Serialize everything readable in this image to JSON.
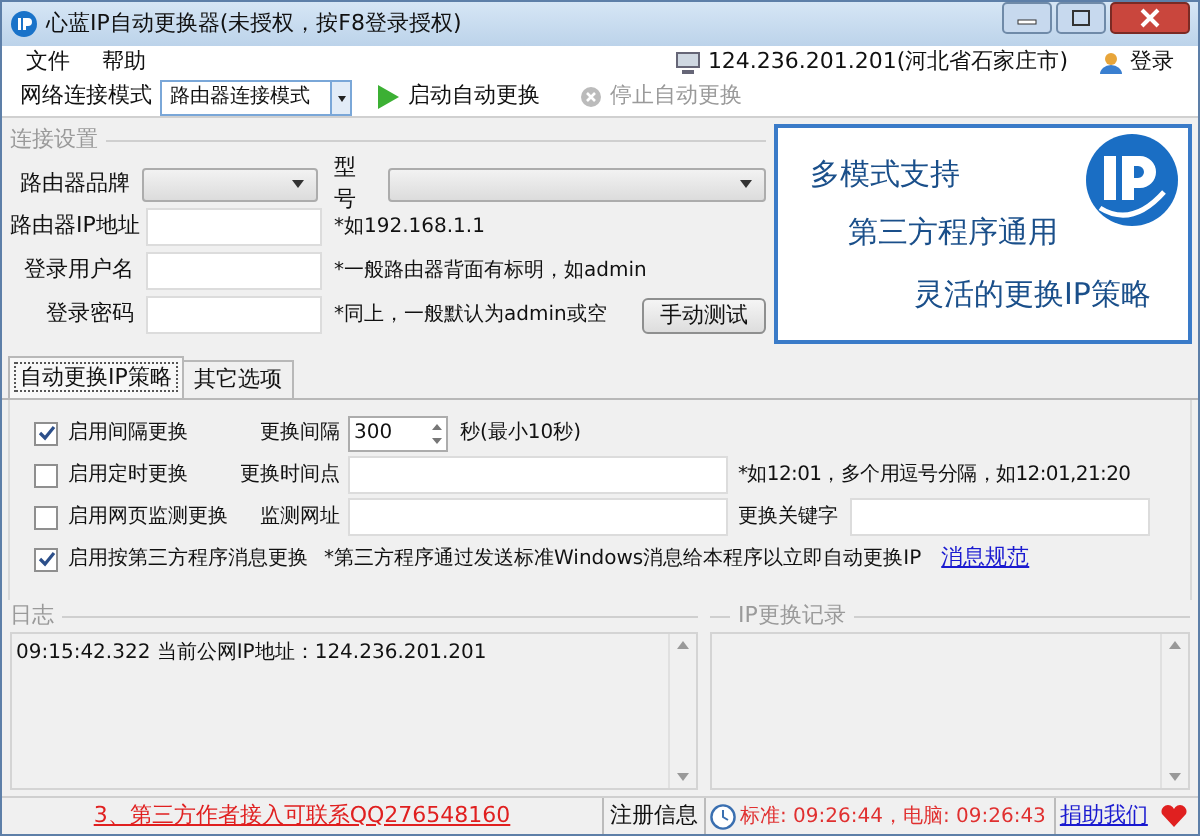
{
  "window": {
    "title": "心蓝IP自动更换器(未授权，按F8登录授权)"
  },
  "menu": [
    {
      "label": "文件"
    },
    {
      "label": "帮助"
    }
  ],
  "toolbar": {
    "mode_label": "网络连接模式",
    "mode_value": "路由器连接模式",
    "start": {
      "label": "启动自动更换",
      "disabled": false
    },
    "stop": {
      "label": "停止自动更换",
      "disabled": true
    },
    "ip_info": "124.236.201.201(河北省石家庄市)",
    "login": "登录"
  },
  "connection": {
    "title": "连接设置",
    "brand": {
      "label": "路由器品牌"
    },
    "model": {
      "label": "型号"
    },
    "fields": [
      {
        "label": "路由器IP地址",
        "hint": "*如192.168.1.1"
      },
      {
        "label": "登录用户名",
        "hint": "*一般路由器背面有标明，如admin"
      },
      {
        "label": "登录密码",
        "hint": "*同上，一般默认为admin或空"
      }
    ],
    "test_button": "手动测试"
  },
  "banner": {
    "lines": [
      "多模式支持",
      "第三方程序通用",
      "灵活的更换IP策略"
    ]
  },
  "tabs": [
    {
      "label": "自动更换IP策略",
      "selected": true
    },
    {
      "label": "其它选项",
      "selected": false
    }
  ],
  "options": [
    {
      "label": "启用间隔更换",
      "checked": true,
      "field_label": "更换间隔",
      "value": "300",
      "hint": "秒(最小10秒)"
    },
    {
      "label": "启用定时更换",
      "checked": false,
      "field_label": "更换时间点",
      "hint": "*如12:01，多个用逗号分隔，如12:01,21:20"
    },
    {
      "label": "启用网页监测更换",
      "checked": false,
      "field_label": "监测网址",
      "extra_label": "更换关键字"
    },
    {
      "label": "启用按第三方程序消息更换",
      "checked": true,
      "hint": "*第三方程序通过发送标准Windows消息给本程序以立即自动更换IP",
      "link": "消息规范"
    }
  ],
  "log": {
    "title": "日志",
    "lines": [
      "09:15:42.322 当前公网IP地址：124.236.201.201"
    ]
  },
  "ip_record": {
    "title": "IP更换记录"
  },
  "status_bar": {
    "notice": "3、第三方作者接入可联系QQ276548160",
    "reg_info": "注册信息",
    "time": "标准: 09:26:44，电脑: 09:26:43",
    "donate": "捐助我们"
  }
}
